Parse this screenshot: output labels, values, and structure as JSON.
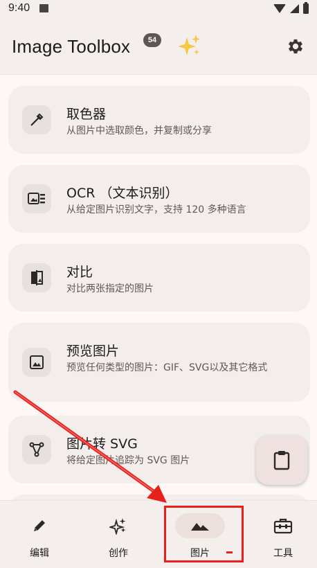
{
  "status_bar": {
    "time": "9:40"
  },
  "app_bar": {
    "title": "Image Toolbox",
    "badge": "54"
  },
  "tools": [
    {
      "title": "取色器",
      "desc": "从图片中选取颜色，并复制或分享"
    },
    {
      "title": "OCR （文本识别）",
      "desc": "从给定图片识别文字，支持 120 多种语言"
    },
    {
      "title": "对比",
      "desc": "对比两张指定的图片"
    },
    {
      "title": "预览图片",
      "desc": "预览任何类型的图片：GIF、SVG以及其它格式"
    },
    {
      "title": "图片转 SVG",
      "desc": "将给定图片追踪为 SVG 图片"
    }
  ],
  "bottom_nav": [
    {
      "label": "编辑",
      "icon": "pencil-icon"
    },
    {
      "label": "创作",
      "icon": "sparkle-icon"
    },
    {
      "label": "图片",
      "icon": "image-icon"
    },
    {
      "label": "工具",
      "icon": "toolbox-icon"
    }
  ],
  "colors": {
    "annotation": "#e8201c",
    "background": "#fdf8f6",
    "card": "#f3eeec"
  }
}
